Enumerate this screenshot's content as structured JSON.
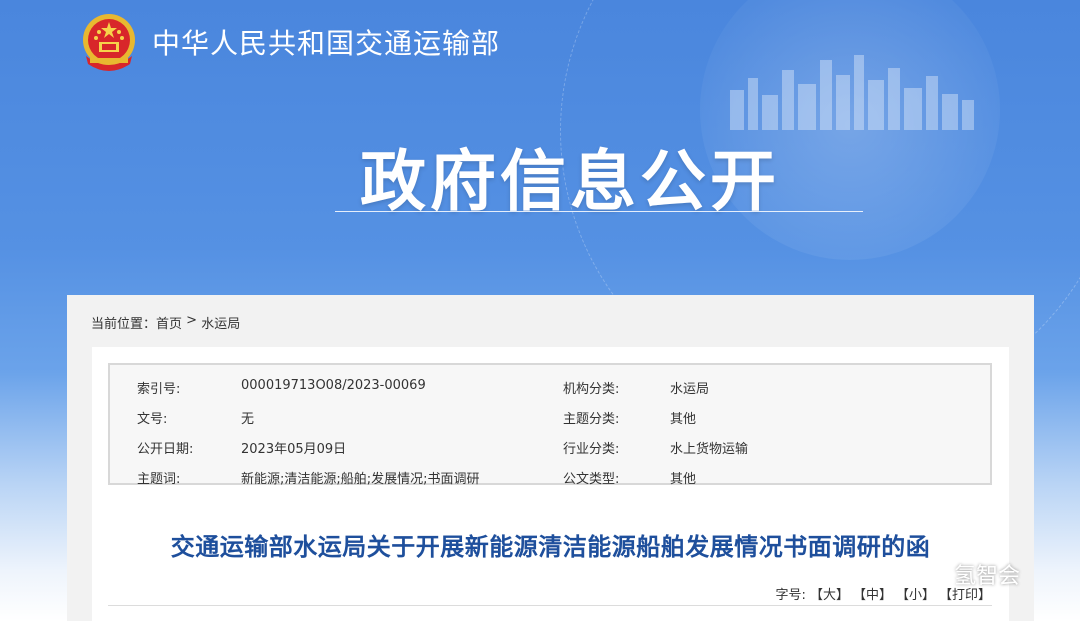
{
  "header": {
    "ministry_name": "中华人民共和国交通运输部",
    "section_title": "政府信息公开"
  },
  "breadcrumb": {
    "prefix": "当前位置：",
    "home": "首页",
    "separator": " > ",
    "current": "水运局"
  },
  "meta": {
    "rows": [
      {
        "label1": "索引号:",
        "value1": "000019713O08/2023-00069",
        "label2": "机构分类:",
        "value2": "水运局"
      },
      {
        "label1": "文号:",
        "value1": "无",
        "label2": "主题分类:",
        "value2": "其他"
      },
      {
        "label1": "公开日期:",
        "value1": "2023年05月09日",
        "label2": "行业分类:",
        "value2": "水上货物运输"
      },
      {
        "label1": "主题词:",
        "value1": "新能源;清洁能源;船舶;发展情况;书面调研",
        "label2": "公文类型:",
        "value2": "其他"
      }
    ]
  },
  "document": {
    "title": "交通运输部水运局关于开展新能源清洁能源船舶发展情况书面调研的函"
  },
  "font_size_controls": {
    "label": "字号:",
    "large": "【大】",
    "medium": "【中】",
    "small": "【小】",
    "print": "【打印】"
  },
  "watermark": {
    "text": "氢智会"
  },
  "colors": {
    "hero_blue": "#4a86dd",
    "title_blue": "#1e4f9c"
  }
}
